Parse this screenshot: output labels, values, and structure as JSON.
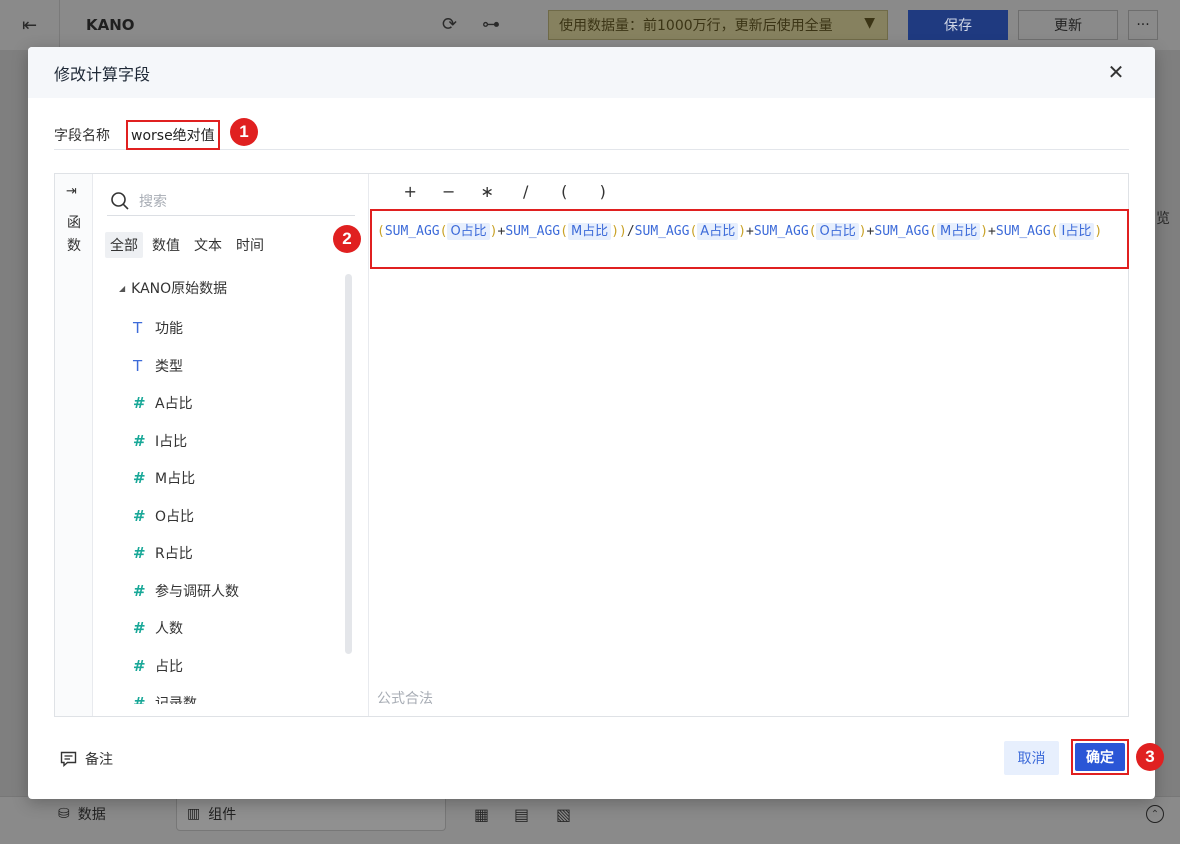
{
  "app": {
    "title": "KANO",
    "notice": "使用数据量：前1000万行，更新后使用全量",
    "save_label": "保存",
    "update_label": "更新",
    "more_label": "···",
    "side_text": "览",
    "bottom_tabs": {
      "data": "数据",
      "component": "组件"
    }
  },
  "dialog": {
    "title": "修改计算字段",
    "field_name_label": "字段名称",
    "field_name_value": "worse绝对值",
    "side_rail_label": "函数",
    "search_placeholder": "搜索",
    "filters": [
      "全部",
      "数值",
      "文本",
      "时间"
    ],
    "tree": {
      "group": "KANO原始数据",
      "items": [
        {
          "label": "功能",
          "type": "text"
        },
        {
          "label": "类型",
          "type": "text"
        },
        {
          "label": "A占比",
          "type": "number"
        },
        {
          "label": "I占比",
          "type": "number"
        },
        {
          "label": "M占比",
          "type": "number"
        },
        {
          "label": "O占比",
          "type": "number"
        },
        {
          "label": "R占比",
          "type": "number"
        },
        {
          "label": "参与调研人数",
          "type": "number"
        },
        {
          "label": "人数",
          "type": "number"
        },
        {
          "label": "占比",
          "type": "number"
        },
        {
          "label": "记录数",
          "type": "number"
        }
      ]
    },
    "operators": [
      "+",
      "−",
      "∗",
      "/",
      "(",
      ")"
    ],
    "formula": [
      {
        "t": "p",
        "v": "("
      },
      {
        "t": "fn",
        "v": "SUM_AGG"
      },
      {
        "t": "p",
        "v": "("
      },
      {
        "t": "tok",
        "v": "O占比"
      },
      {
        "t": "p",
        "v": ")"
      },
      {
        "t": "op",
        "v": "+"
      },
      {
        "t": "fn",
        "v": "SUM_AGG"
      },
      {
        "t": "p",
        "v": "("
      },
      {
        "t": "tok",
        "v": "M占比"
      },
      {
        "t": "p",
        "v": "))"
      },
      {
        "t": "op",
        "v": "/"
      },
      {
        "t": "fn",
        "v": "SUM_AGG"
      },
      {
        "t": "p",
        "v": "("
      },
      {
        "t": "tok",
        "v": "A占比"
      },
      {
        "t": "p",
        "v": ")"
      },
      {
        "t": "op",
        "v": "+"
      },
      {
        "t": "fn",
        "v": "SUM_AGG"
      },
      {
        "t": "p",
        "v": "("
      },
      {
        "t": "tok",
        "v": "O占比"
      },
      {
        "t": "p",
        "v": ")"
      },
      {
        "t": "op",
        "v": "+"
      },
      {
        "t": "fn",
        "v": "SUM_AGG"
      },
      {
        "t": "p",
        "v": "("
      },
      {
        "t": "tok",
        "v": "M占比"
      },
      {
        "t": "p",
        "v": ")"
      },
      {
        "t": "op",
        "v": "+"
      },
      {
        "t": "fn",
        "v": "SUM_AGG"
      },
      {
        "t": "p",
        "v": "("
      },
      {
        "t": "tok",
        "v": "I占比"
      },
      {
        "t": "p",
        "v": ")"
      }
    ],
    "formula_status": "公式合法",
    "remark_label": "备注",
    "cancel_label": "取消",
    "ok_label": "确定",
    "markers": [
      "1",
      "2",
      "3"
    ]
  },
  "colors": {
    "accent": "#2a56d6",
    "highlight": "#e02020",
    "token_bg": "#e7effd",
    "number_icon": "#19a898",
    "text_icon": "#3d6bd9"
  }
}
